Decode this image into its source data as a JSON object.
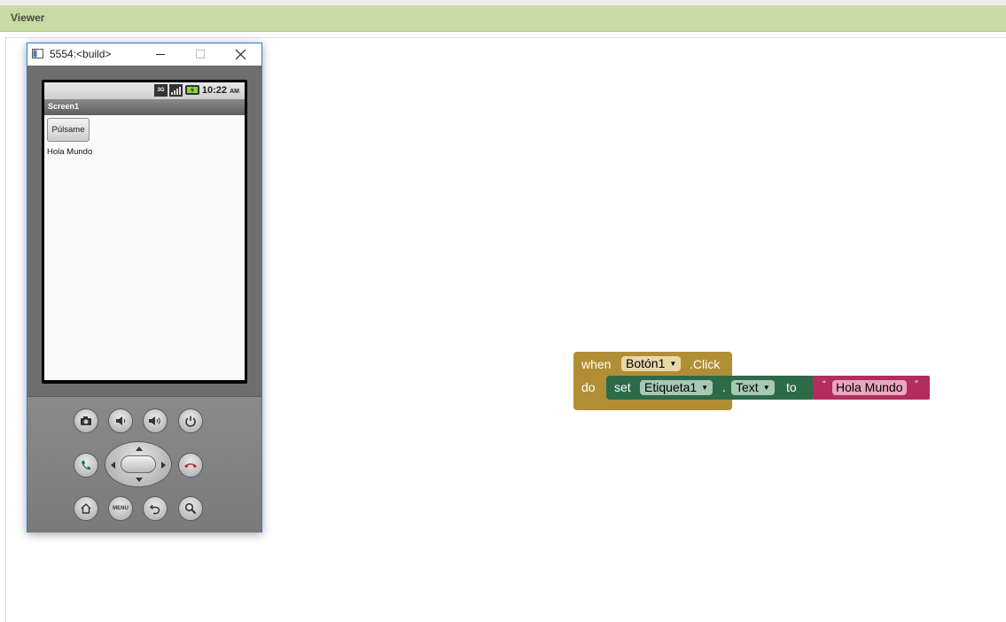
{
  "viewer": {
    "title": "Viewer"
  },
  "emulator": {
    "window_title": "5554:<build>",
    "status_bar": {
      "network": "3G",
      "time": "10:22",
      "ampm": "AM"
    },
    "app": {
      "screen_title": "Screen1",
      "button_label": "Púlsame",
      "label_text": "Hola Mundo"
    },
    "hardware_buttons": [
      "camera-icon",
      "volume-down-icon",
      "volume-up-icon",
      "power-icon",
      "call-icon",
      "dpad",
      "end-call-icon",
      "home-icon",
      "menu",
      "back-icon",
      "search-icon"
    ],
    "menu_label": "MENU"
  },
  "blocks": {
    "event": {
      "when_label": "when",
      "component": "Botón1",
      "event_name": ".Click",
      "do_label": "do"
    },
    "setter": {
      "set_label": "set",
      "component": "Etiqueta1",
      "dot": ".",
      "property": "Text",
      "to_label": "to"
    },
    "string": {
      "open_quote": "“",
      "value": "Hola Mundo",
      "close_quote": "”"
    },
    "colors": {
      "event": "#b18e35",
      "setter": "#2d6a48",
      "text": "#b32d5e"
    }
  }
}
